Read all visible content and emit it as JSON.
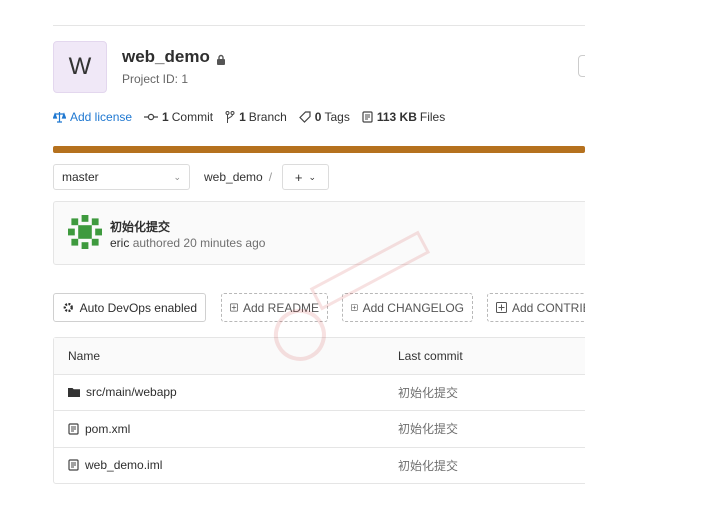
{
  "project": {
    "avatar_letter": "W",
    "name": "web_demo",
    "id_text": "Project ID: 1"
  },
  "stats": {
    "license": "Add license",
    "commit_count": "1",
    "commit_label": "Commit",
    "branch_count": "1",
    "branch_label": "Branch",
    "tag_count": "0",
    "tag_label": "Tags",
    "files_size": "113 KB",
    "files_label": "Files"
  },
  "language_bar_color": "#b5711e",
  "repo_nav": {
    "branch": "master",
    "breadcrumb": "web_demo",
    "separator": "/",
    "plus_label": "+"
  },
  "last_commit": {
    "title": "初始化提交",
    "author": "eric",
    "meta": "authored 20 minutes ago"
  },
  "actions": {
    "auto_devops": "Auto DevOps enabled",
    "add_readme": "Add README",
    "add_changelog": "Add CHANGELOG",
    "add_contributing": "Add CONTRIBUTING"
  },
  "table": {
    "columns": [
      "Name",
      "Last commit"
    ],
    "rows": [
      {
        "icon": "folder-icon",
        "name": "src/main/webapp",
        "commit": "初始化提交"
      },
      {
        "icon": "file-icon",
        "name": "pom.xml",
        "commit": "初始化提交"
      },
      {
        "icon": "file-icon",
        "name": "web_demo.iml",
        "commit": "初始化提交"
      }
    ]
  }
}
